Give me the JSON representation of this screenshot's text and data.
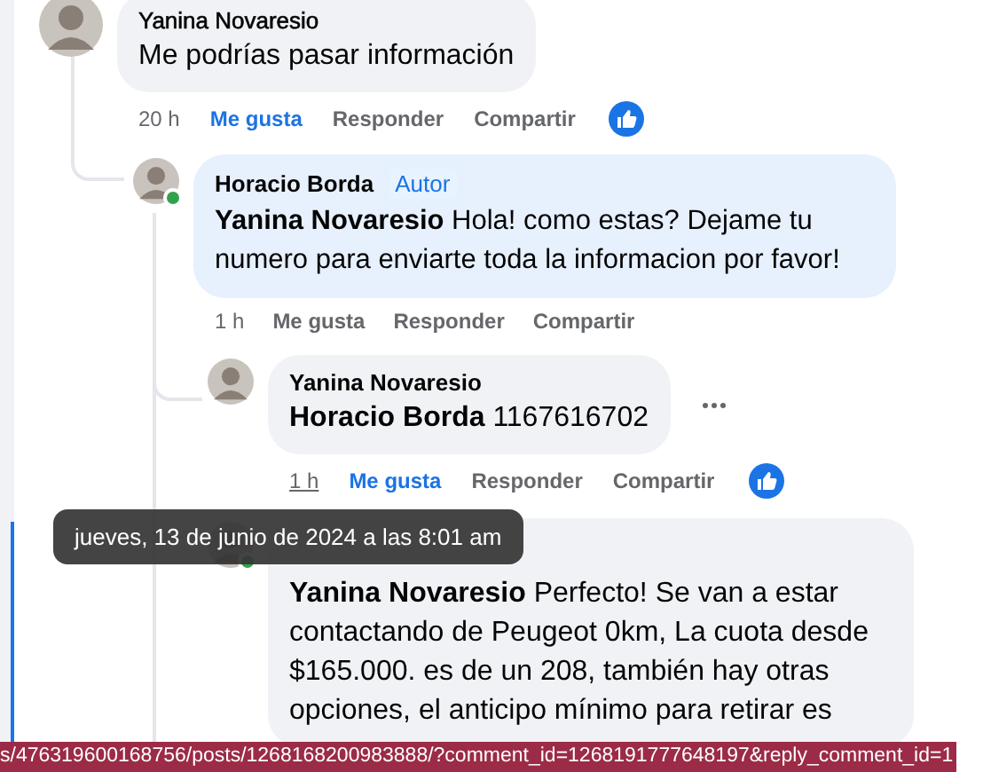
{
  "comments": [
    {
      "author": "Yanina Novaresio",
      "text": "Me podrías pasar información",
      "time": "20 h",
      "time_hovered": false,
      "liked": true,
      "reaction": true,
      "actions": [
        "Me gusta",
        "Responder",
        "Compartir"
      ],
      "children": [
        {
          "author": "Horacio Borda",
          "badge": "Autor",
          "text": "**Yanina Novaresio** Hola! como estas? Dejame tu numero para enviarte toda la informacion por favor!",
          "time": "1 h",
          "time_hovered": false,
          "liked": false,
          "online": true,
          "actions": [
            "Me gusta",
            "Responder",
            "Compartir"
          ],
          "children": [
            {
              "author": "Yanina Novaresio",
              "text": "**Horacio Borda** 1167616702",
              "time": "1 h",
              "time_hovered": true,
              "liked": true,
              "reaction": true,
              "menu": true,
              "actions": [
                "Me gusta",
                "Responder",
                "Compartir"
              ]
            },
            {
              "text": "**Yanina Novaresio** Perfecto! Se van a estar contactando de Peugeot 0km, La cuota desde $165.000. es de un 208, también hay otras opciones, el anticipo mínimo para retirar es",
              "online": true
            }
          ]
        }
      ]
    }
  ],
  "tooltip": {
    "text": "jueves, 13 de junio de 2024 a las 8:01 am"
  },
  "status_bar": {
    "url": "s/476319600168756/posts/1268168200983888/?comment_id=1268191777648197&reply_comment_id=1"
  }
}
